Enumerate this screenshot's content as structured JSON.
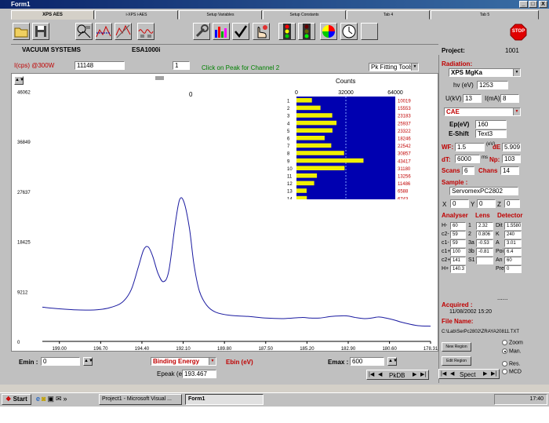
{
  "window": {
    "title": "Form1",
    "minimize": "_",
    "maximize": "□",
    "close": "X"
  },
  "tabs": [
    "XPS AES",
    "i-XPS i-AES",
    "Setup Variables",
    "Setup Constants",
    "Tab 4",
    "Tab 5"
  ],
  "toolbar": {
    "icons": [
      "open-folder-icon",
      "save-disk-icon",
      "instrument-icon",
      "spectrum-fit-icon",
      "spectrum-tools-icon",
      "wrench-icon",
      "bar-chart-icon",
      "checkmark-icon",
      "hand-pointer-icon",
      "traffic-light-icon",
      "traffic-light-go-icon",
      "color-wheel-icon",
      "clock-icon",
      "blank-icon"
    ],
    "stop_label": "STOP"
  },
  "header": {
    "vendor": "VACUUM SYSTEMS",
    "model": "ESA1000i",
    "project_label": "Project:",
    "project_value": "1001"
  },
  "graph_header": {
    "intensity_label": "I(cps) @300W",
    "intensity_value": "11148",
    "channel_value": "1",
    "hint": "Click on Peak for Channel 2",
    "fit_tools": "Pk Fitting Tools"
  },
  "plot": {
    "zero_label": "0",
    "counts_label": "Counts"
  },
  "chart_data": {
    "type": "line",
    "xlabel": "",
    "ylabel": "I(cps) @300W",
    "x_ticks": [
      "199.00",
      "196.70",
      "194.40",
      "192.10",
      "189.80",
      "187.50",
      "185.20",
      "182.90",
      "180.60",
      "178.31"
    ],
    "y_ticks": [
      "46062",
      "36849",
      "27637",
      "18425",
      "9212",
      "0"
    ],
    "xlim": [
      199.95,
      178.31
    ],
    "ylim": [
      0,
      48000
    ],
    "x": [
      199.95,
      199.0,
      198.0,
      197.0,
      196.2,
      195.5,
      195.0,
      194.6,
      194.3,
      194.05,
      193.8,
      193.5,
      193.2,
      192.9,
      192.55,
      192.3,
      192.05,
      191.75,
      191.5,
      191.2,
      190.8,
      190.3,
      189.5,
      188.5,
      187.5,
      186.5,
      185.5,
      185.0,
      184.5,
      183.8,
      183.0,
      182.5,
      182.0,
      181.6,
      181.2,
      180.8,
      180.4,
      180.0,
      179.5,
      179.0,
      178.31
    ],
    "y": [
      6300,
      6000,
      5800,
      5800,
      6200,
      7200,
      9500,
      13700,
      16900,
      17400,
      15700,
      12500,
      11000,
      13000,
      21500,
      26100,
      25600,
      20800,
      14200,
      9300,
      6700,
      5400,
      4800,
      4600,
      4300,
      4200,
      4400,
      4300,
      4300,
      4600,
      4700,
      4400,
      4200,
      4300,
      4500,
      4300,
      4000,
      3600,
      3200,
      2900,
      2800
    ],
    "counts": {
      "axis_ticks": [
        "0",
        "32000",
        "64000"
      ],
      "max": 64000,
      "channels": [
        "1",
        "2",
        "3",
        "4",
        "5",
        "6",
        "7",
        "8",
        "9",
        "10",
        "11",
        "12",
        "13",
        "14"
      ],
      "values": [
        10019,
        15553,
        23183,
        25937,
        23322,
        18246,
        22542,
        30857,
        43417,
        31180,
        13256,
        11486,
        6588,
        6743
      ],
      "labels": [
        "10019",
        "15553",
        "23183",
        "25937",
        "23322",
        "18246",
        "22542",
        "30857",
        "43417",
        "31180",
        "13256",
        "11486",
        "6588",
        "6743"
      ]
    }
  },
  "bottom": {
    "emin_label": "Emin :",
    "emin_value": "0",
    "energy_mode": "Binding Energy",
    "ebin_label": "Ebin (eV)",
    "emax_label": "Emax :",
    "emax_value": "600",
    "epeak_label": "Epeak (eV)",
    "epeak_value": "193.467",
    "pkdb": "PkDB"
  },
  "right": {
    "radiation_label": "Radiation:",
    "source": "XPS MgKa",
    "hv_label": "hv (eV)",
    "hv_value": "1253",
    "u_label": "U(kV)",
    "u_value": "13",
    "i_label": "I(mA)",
    "i_value": "8",
    "mode": "CAE",
    "ep_label": "Ep(eV)",
    "ep_value": "160",
    "eshift_label": "E-Shift",
    "eshift_value": "Text3",
    "wf_label": "WF:",
    "wf_value": "1.5",
    "ev_label": "(eV)",
    "de_label": "dE",
    "de_value": "5.909",
    "dt_label": "dT:",
    "dt_value": "6000",
    "ms_label": "ms",
    "np_label": "Np:",
    "np_value": "103",
    "scans_label": "Scans",
    "scans_value": "6",
    "chans_label": "Chans",
    "chans_value": "14",
    "sample_label": "Sample :",
    "sample_value": "ServomexPC2802",
    "x_label": "X",
    "x_value": "0",
    "y_label": "Y",
    "y_value": "0",
    "z_label": "Z",
    "z_value": "0",
    "analyser_label": "Analyser",
    "lens_label": "Lens",
    "detector_label": "Detector",
    "analyser": [
      {
        "label": "H-",
        "value": "60"
      },
      {
        "label": "c2-",
        "value": "59"
      },
      {
        "label": "c1-",
        "value": "59"
      },
      {
        "label": "c1+",
        "value": "100"
      },
      {
        "label": "c2+",
        "value": "141"
      },
      {
        "label": "H+",
        "value": "140.3"
      }
    ],
    "lens": [
      {
        "label": "1",
        "value": "2.32"
      },
      {
        "label": "2",
        "value": "0.806"
      },
      {
        "label": "3a",
        "value": "-0.53"
      },
      {
        "label": "3b",
        "value": "-0.81"
      },
      {
        "label": "S1",
        "value": ""
      }
    ],
    "detector": [
      {
        "label": "Dit",
        "value": "1.5580"
      },
      {
        "label": "K",
        "value": "240"
      },
      {
        "label": "A",
        "value": "3.01"
      },
      {
        "label": "Poi",
        "value": "6.4"
      },
      {
        "label": "An",
        "value": "60"
      },
      {
        "label": "Pre",
        "value": "0"
      }
    ],
    "dots": "......",
    "acquired_label": "Acquired :",
    "acquired_value": "11/08/2002  15:20",
    "file_label": "File Name:",
    "file_value": "C:\\Lab\\SerPc2802\\ZRAYA20811.TXT",
    "new_region": "New Region",
    "edit_region": "Edit Region",
    "zoom": "Zoom",
    "man": "Man.",
    "res": "Res.",
    "mcd": "MCD",
    "spect": "Spect"
  },
  "taskbar": {
    "start": "Start",
    "items": [
      "Project1 - Microsoft Visual ...",
      "Form1"
    ],
    "clock": "17:40"
  }
}
